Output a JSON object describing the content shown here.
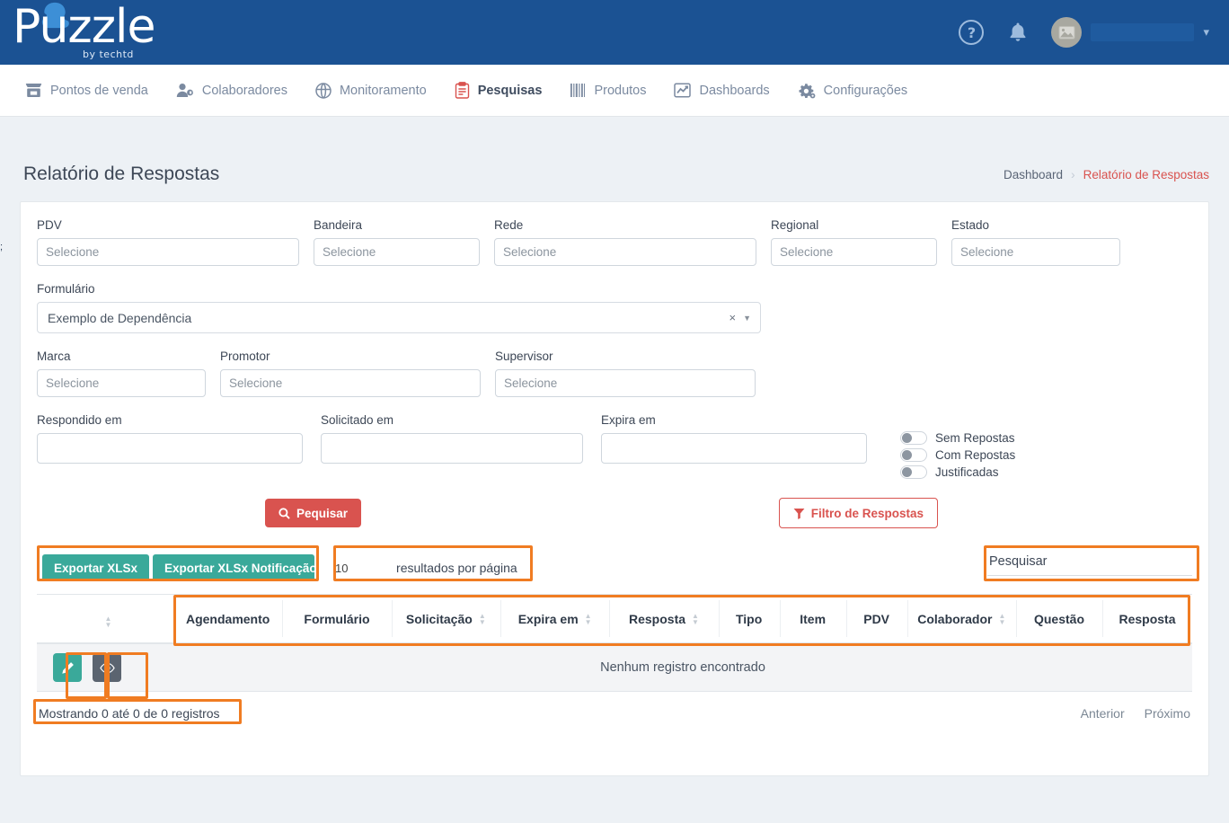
{
  "brand": {
    "name": "Puzzle",
    "tagline": "by techtd"
  },
  "topbar": {
    "help_icon": "help-circle-icon",
    "bell_icon": "bell-icon",
    "avatar_icon": "image-placeholder-icon",
    "user_name": "",
    "caret_icon": "chevron-down-icon"
  },
  "nav": {
    "items": [
      {
        "label": "Pontos de venda",
        "icon": "store-icon",
        "active": false
      },
      {
        "label": "Colaboradores",
        "icon": "user-tag-icon",
        "active": false
      },
      {
        "label": "Monitoramento",
        "icon": "umbrella-icon",
        "active": false
      },
      {
        "label": "Pesquisas",
        "icon": "clipboard-icon",
        "active": true
      },
      {
        "label": "Produtos",
        "icon": "barcode-icon",
        "active": false
      },
      {
        "label": "Dashboards",
        "icon": "chart-line-icon",
        "active": false
      },
      {
        "label": "Configurações",
        "icon": "gears-icon",
        "active": false
      }
    ]
  },
  "page": {
    "fragment": ";",
    "title": "Relatório de Respostas",
    "breadcrumb": {
      "root": "Dashboard",
      "separator": "›",
      "current": "Relatório de Respostas"
    }
  },
  "filters": {
    "pdv": {
      "label": "PDV",
      "value": "",
      "placeholder": "Selecione"
    },
    "bandeira": {
      "label": "Bandeira",
      "value": "",
      "placeholder": "Selecione"
    },
    "rede": {
      "label": "Rede",
      "value": "",
      "placeholder": "Selecione"
    },
    "regional": {
      "label": "Regional",
      "value": "",
      "placeholder": "Selecione"
    },
    "estado": {
      "label": "Estado",
      "value": "",
      "placeholder": "Selecione"
    },
    "formulario": {
      "label": "Formulário",
      "value": "Exemplo de Dependência",
      "clear": "×",
      "caret": "▼"
    },
    "marca": {
      "label": "Marca",
      "value": "",
      "placeholder": "Selecione"
    },
    "promotor": {
      "label": "Promotor",
      "value": "",
      "placeholder": "Selecione"
    },
    "supervisor": {
      "label": "Supervisor",
      "value": "",
      "placeholder": "Selecione"
    },
    "respondido_em": {
      "label": "Respondido em",
      "value": "",
      "placeholder": ""
    },
    "solicitado_em": {
      "label": "Solicitado em",
      "value": "",
      "placeholder": ""
    },
    "expira_em": {
      "label": "Expira em",
      "value": "",
      "placeholder": ""
    },
    "toggles": [
      {
        "label": "Sem Repostas",
        "on": false
      },
      {
        "label": "Com Repostas",
        "on": false
      },
      {
        "label": "Justificadas",
        "on": false
      }
    ],
    "search_button": {
      "label": "Pequisar",
      "icon": "search-icon"
    },
    "filter_button": {
      "label": "Filtro de Respostas",
      "icon": "funnel-icon"
    }
  },
  "toolbar": {
    "export_xlsx": "Exportar XLSx",
    "export_xlsx_notification": "Exportar XLSx Notificação",
    "per_page_value": "10",
    "per_page_label": "resultados por página",
    "search_placeholder": "Pesquisar",
    "search_value": ""
  },
  "table": {
    "columns": [
      {
        "label": "",
        "sortable": true
      },
      {
        "label": "Agendamento",
        "sortable": false
      },
      {
        "label": "Formulário",
        "sortable": false
      },
      {
        "label": "Solicitação",
        "sortable": true
      },
      {
        "label": "Expira em",
        "sortable": true
      },
      {
        "label": "Resposta",
        "sortable": true
      },
      {
        "label": "Tipo",
        "sortable": false
      },
      {
        "label": "Item",
        "sortable": false
      },
      {
        "label": "PDV",
        "sortable": false
      },
      {
        "label": "Colaborador",
        "sortable": true
      },
      {
        "label": "Questão",
        "sortable": false
      },
      {
        "label": "Resposta",
        "sortable": false
      }
    ],
    "empty_message": "Nenhum registro encontrado",
    "row_actions": [
      {
        "name": "edit-row-button",
        "icon": "pencil-icon"
      },
      {
        "name": "view-row-button",
        "icon": "eye-icon"
      }
    ]
  },
  "footer": {
    "showing": "Mostrando 0 até 0 de 0 registros",
    "prev": "Anterior",
    "next": "Próximo"
  },
  "colors": {
    "header_blue": "#1b5293",
    "accent_red": "#d9534f",
    "teal": "#3aa99a",
    "annotation_orange": "#f07c22"
  }
}
